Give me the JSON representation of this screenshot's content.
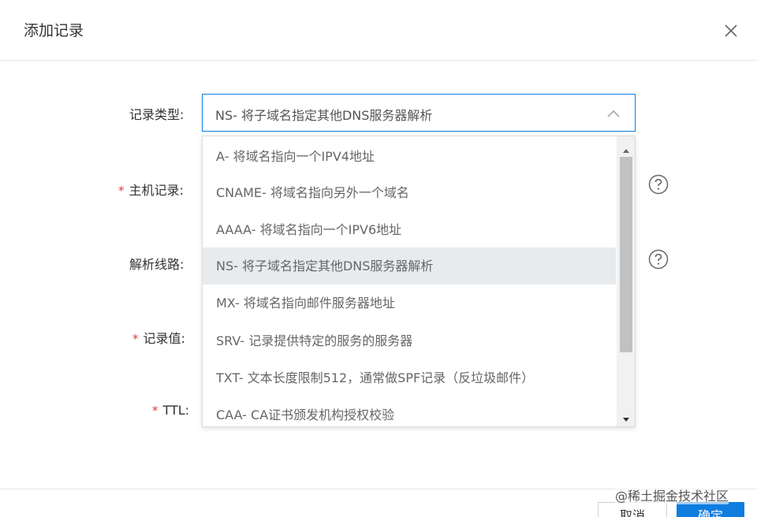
{
  "dialog": {
    "title": "添加记录",
    "close_icon": "close-icon"
  },
  "form": {
    "record_type_label": "记录类型:",
    "host_label": "主机记录:",
    "line_label": "解析线路:",
    "value_label": "记录值:",
    "ttl_label": "TTL:",
    "required_mark": "*",
    "record_type_selected": "NS- 将子域名指定其他DNS服务器解析",
    "help_icon": "question-circle-icon"
  },
  "dropdown": {
    "options": [
      "A- 将域名指向一个IPV4地址",
      "CNAME- 将域名指向另外一个域名",
      "AAAA- 将域名指向一个IPV6地址",
      "NS- 将子域名指定其他DNS服务器解析",
      "MX- 将域名指向邮件服务器地址",
      "SRV- 记录提供特定的服务的服务器",
      "TXT- 文本长度限制512，通常做SPF记录（反垃圾邮件）",
      "CAA- CA证书颁发机构授权校验"
    ],
    "selected_index": 3
  },
  "footer": {
    "cancel_label": "取消",
    "ok_label": "确定"
  },
  "watermark": "@稀土掘金技术社区",
  "colors": {
    "accent": "#0f7de0",
    "required": "#e5383b",
    "selected_bg": "#e8ebed"
  }
}
